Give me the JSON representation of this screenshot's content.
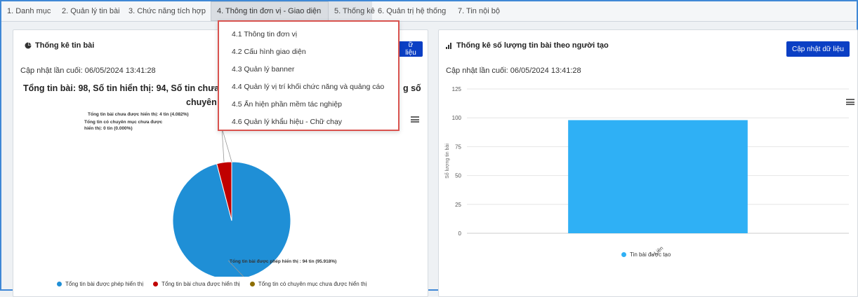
{
  "nav": {
    "tabs": [
      {
        "label": "1. Danh mục"
      },
      {
        "label": "2. Quản lý tin bài"
      },
      {
        "label": "3. Chức năng tích hợp"
      },
      {
        "label": "4. Thông tin đơn vị - Giao diện"
      },
      {
        "label": "5. Thống kê"
      },
      {
        "label": "6. Quản trị hệ thống"
      },
      {
        "label": "7. Tin nội bộ"
      }
    ],
    "active_index": 3,
    "highlight_index": 4
  },
  "dropdown": {
    "items": [
      {
        "label": "4.1 Thông tin đơn vị"
      },
      {
        "label": "4.2 Cấu hình giao diện"
      },
      {
        "label": "4.3 Quản lý banner"
      },
      {
        "label": "4.4 Quản lý vị trí khối chức năng và quảng cáo"
      },
      {
        "label": "4.5 Ẩn hiện phần mềm tác nghiệp"
      },
      {
        "label": "4.6 Quản lý khẩu hiệu - Chữ chạy"
      }
    ],
    "border_color": "#d9534f"
  },
  "left_panel": {
    "title": "Thống kê tin bài",
    "title_icon": "pie-chart-icon",
    "update_button": "ữ liệu",
    "last_updated": "Cập nhật lần cuối: 06/05/2024 13:41:28",
    "summary_line1_left": "Tổng tin bài: 98, Số tin hiển thị: 94, Số tin chưa h",
    "summary_line1_right": "g số",
    "summary_line2": "chuyên",
    "menu_icon": "hamburger-menu-icon"
  },
  "right_panel": {
    "title": "Thống kê số lượng tin bài theo người tạo",
    "title_icon": "bar-chart-icon",
    "update_button": "Cập nhật dữ liệu",
    "last_updated": "Cập nhật lần cuối: 06/05/2024 13:41:28",
    "menu_icon": "hamburger-menu-icon"
  },
  "colors": {
    "accent_blue": "#0b3fc4",
    "series_blue": "#1f8fd6",
    "series_red": "#c00000",
    "series_olive": "#8c6d00",
    "bar_blue": "#2fb0f5"
  },
  "chart_data": [
    {
      "type": "pie",
      "slices": [
        {
          "name": "Tổng tin bài được phép hiển thị",
          "value": 94,
          "percent": 95.918,
          "color": "#1f8fd6",
          "label": "Tổng tin bài được phép hiển thị : 94 tin (95.918%)"
        },
        {
          "name": "Tổng tin bài chưa được hiển thị",
          "value": 4,
          "percent": 4.082,
          "color": "#c00000",
          "label": "Tổng tin bài chưa được hiển thị: 4 tin (4.082%)"
        },
        {
          "name": "Tổng tin có chuyên mục chưa được hiển thị",
          "value": 0,
          "percent": 0.0,
          "color": "#8c6d00",
          "label": "Tổng tin có chuyên mục chưa được hiển thị: 0 tin (0.000%)"
        }
      ],
      "legend_position": "bottom"
    },
    {
      "type": "bar",
      "categories": [
        "Phương Liên"
      ],
      "series": [
        {
          "name": "Tin bài được tạo",
          "values": [
            98
          ],
          "color": "#2fb0f5"
        }
      ],
      "ylabel": "Số lượng tin bài",
      "ylim": [
        0,
        125
      ],
      "yticks": [
        0,
        25,
        50,
        75,
        100,
        125
      ],
      "grid": true,
      "legend_position": "bottom"
    }
  ]
}
